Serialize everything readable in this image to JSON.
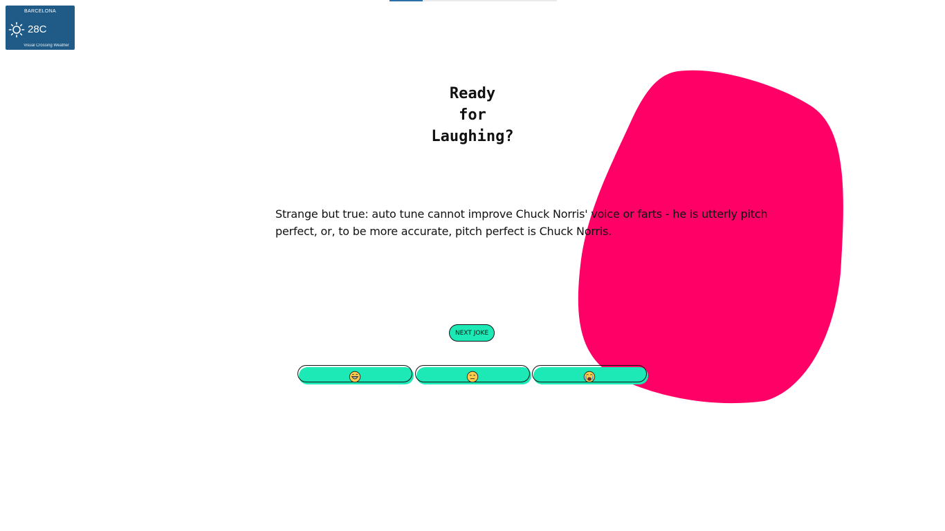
{
  "progress": {
    "fraction": 0.2
  },
  "weather": {
    "city": "BARCELONA",
    "temperature": "28C",
    "brand": "Visual Crossing Weather",
    "icon": "sun-icon"
  },
  "heading": {
    "line1": "Ready",
    "line2": "for",
    "line3": "Laughing?"
  },
  "joke": {
    "text": "Strange but true: auto tune cannot improve Chuck Norris' voice or farts - he is utterly pitch perfect, or, to be more accurate, pitch perfect is Chuck Norris."
  },
  "buttons": {
    "next_joke": "NEXT JOKE"
  },
  "ratings": [
    {
      "icon": "grinning-face-icon"
    },
    {
      "icon": "neutral-face-icon"
    },
    {
      "icon": "crying-face-icon"
    }
  ],
  "colors": {
    "accent": "#1de9b6",
    "blob": "#ff0066",
    "weather_bg": "#1f5b86",
    "progress_fill": "#2a6fa8"
  }
}
